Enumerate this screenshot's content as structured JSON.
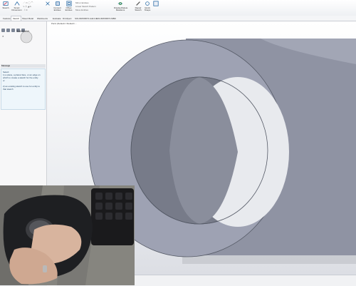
{
  "toolbar": {
    "sketch_label": "Sketch",
    "smart_dimension_label": "Smart\nDimension",
    "convert_entities_label": "Convert\nEntities",
    "offset_entities_label": "Offset\nEntities",
    "mirror_entities_label": "Mirror Entities",
    "linear_pattern_label": "Linear Sketch Pattern",
    "move_entities_label": "Move Entities",
    "display_label": "Display/Delete\nRelations",
    "repair_label": "Repair\nSketch",
    "quick_snaps_label": "Quick\nSnaps"
  },
  "tabs": [
    "Features",
    "Sketch",
    "Sheet Metal",
    "Weldments",
    "Evaluate",
    "DimXpert",
    "SOLIDWORKS Add-Ins",
    "SOLIDWORKS MBD"
  ],
  "active_tab": "Sketch",
  "panel": {
    "title": "Edit Sketch",
    "message_header": "Message",
    "message_lines": [
      "Select:",
      "1) a plane, a planar face, or an edge on",
      "which to create a sketch for the entity",
      "or",
      "",
      "2) an existing sketch to use for entity to",
      "that sketch"
    ]
  },
  "tree": {
    "part_label": "Part1 (Default<<Default>..."
  },
  "colors": {
    "model_face": "#9ea2b3",
    "model_shadow": "#7c7f8f",
    "accent_blue": "#2e6ea8"
  }
}
